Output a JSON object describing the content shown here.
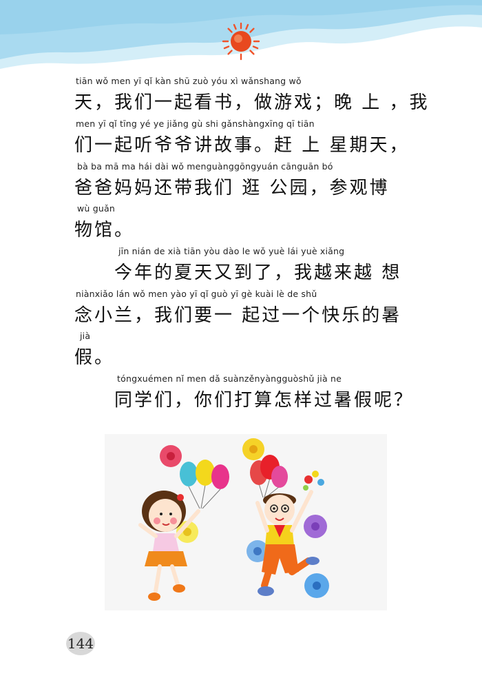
{
  "lines": [
    {
      "pinyin": "tiān    wǒ men  yī   qǐ kàn shū    zuò yóu  xì     wǎnshang     wǒ",
      "hanzi": "天，我们一起看书，做游戏；晚 上 ，我"
    },
    {
      "pinyin": "men  yī   qǐ  tīng  yé   ye  jiǎng gù  shi     gǎnshàngxīng  qī  tiān",
      "hanzi": "们一起听爷爷讲故事。赶 上 星期天，"
    },
    {
      "pinyin": "bà  ba  mā  ma  hái  dài  wǒ  menguànggōngyuán     cānguān  bó",
      "hanzi": "爸爸妈妈还带我们 逛 公园，参观博"
    },
    {
      "pinyin": "wù guǎn",
      "hanzi": "物馆。"
    },
    {
      "pinyin": "jīn  nián  de   xià  tiān yòu dào   le         wǒ  yuè  lái  yuè xiǎng",
      "hanzi": "今年的夏天又到了，我越来越 想"
    },
    {
      "pinyin": "niànxiǎo lán      wǒ men yào  yī     qǐ  guò   yī   gè  kuài  lè   de  shǔ",
      "hanzi": "念小兰，我们要一 起过一个快乐的暑"
    },
    {
      "pinyin": "jià",
      "hanzi": "假。"
    },
    {
      "pinyin": "tóngxuémen       nǐ  men  dǎ  suànzěnyàngguòshǔ  jià   ne",
      "hanzi": "同学们，你们打算怎样过暑假呢？"
    }
  ],
  "page_number": "144",
  "colors": {
    "sky": "#a9daf0",
    "sky_light": "#d4eef8",
    "sun": "#e8491f",
    "sun_rays": "#f0532a",
    "badge": "#d8d8d8"
  },
  "icons": [
    "sun-icon",
    "balloon-icon",
    "flower-icon"
  ]
}
